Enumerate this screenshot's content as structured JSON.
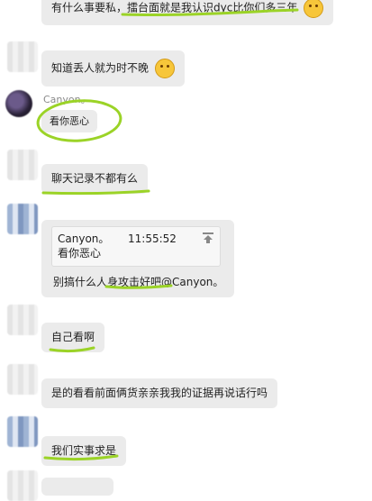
{
  "messages": [
    {
      "text": "有什么事要私，擂台面就是我认识dyc比你们多三年",
      "emoji": "grin-sweat-emoji"
    },
    {
      "text": "知道丢人就为时不晚",
      "emoji": "grin-sweat-emoji"
    },
    {
      "sender": "Canyon。",
      "text": "看你恶心"
    },
    {
      "text": "聊天记录不都有么"
    },
    {
      "quote": {
        "sender": "Canyon。",
        "time": "11:55:52",
        "text": "看你恶心",
        "icon": "arrow-up-icon"
      },
      "text": "别搞什么人身攻击好吧@Canyon。"
    },
    {
      "text": "自己看啊"
    },
    {
      "text": "是的看看前面俩货亲亲我我的证据再说话行吗"
    },
    {
      "text": "我们实事求是"
    }
  ],
  "colors": {
    "bubble": "#ebebeb",
    "highlight": "#9bd327",
    "sender": "#8a8a8a"
  }
}
